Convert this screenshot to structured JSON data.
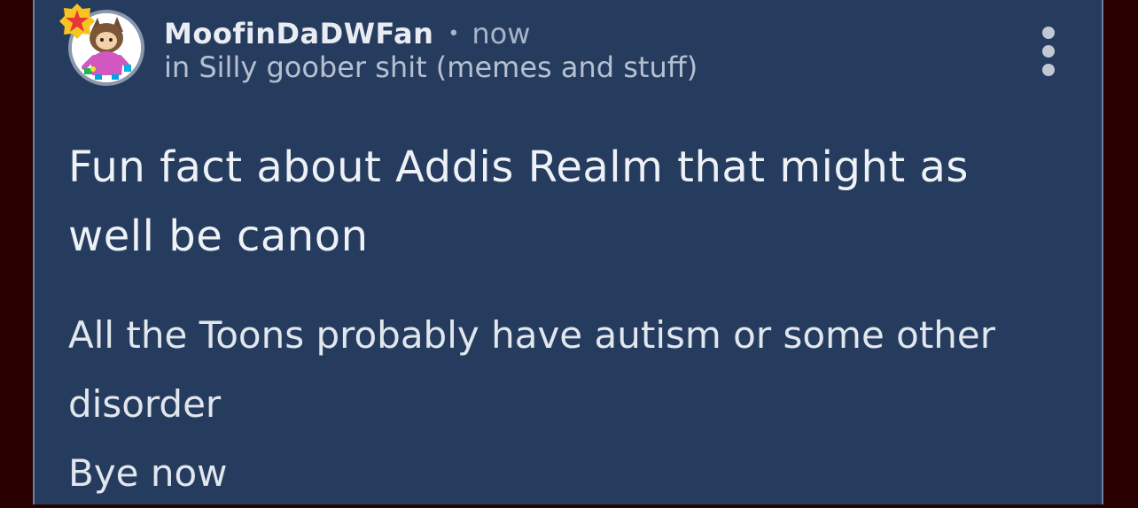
{
  "post": {
    "author": {
      "name": "MoofinDaDWFan",
      "avatar_icon": "character-avatar-icon",
      "badge_icon": "star-badge-icon"
    },
    "separator": "•",
    "timestamp": "now",
    "community": "in Silly goober shit (memes and stuff)",
    "menu_icon": "more-vertical-icon",
    "title": "Fun fact about Addis Realm that might as well be canon",
    "body": {
      "line1": "All the Toons probably have autism or some other disorder",
      "line2": "Bye now"
    }
  },
  "colors": {
    "background": "#2b0000",
    "card": "#263c5f",
    "text": "#eef1f6",
    "muted_text": "#b6c0d1",
    "badge": "#f7c51d",
    "badge_star": "#e7353c"
  }
}
